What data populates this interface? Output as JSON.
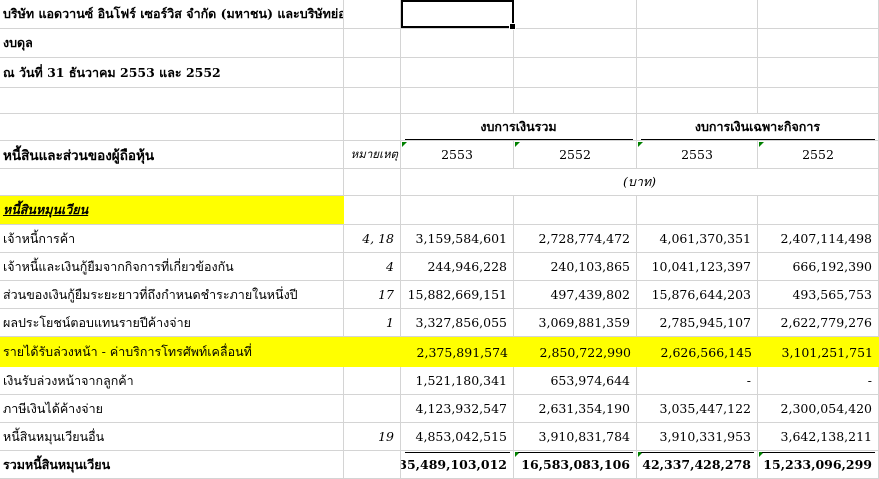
{
  "header": {
    "company": "บริษัท แอดวานซ์ อินโฟร์ เซอร์วิส จำกัด (มหาชน) และบริษัทย่อย",
    "statement": "งบดุล",
    "date_line": "ณ วันที่ 31 ธันวาคม 2553 และ 2552"
  },
  "columns": {
    "group_consolidated": "งบการเงินรวม",
    "group_separate": "งบการเงินเฉพาะกิจการ",
    "section_title": "หนี้สินและส่วนของผู้ถือหุ้น",
    "note_label": "หมายเหตุ",
    "years": [
      "2553",
      "2552",
      "2553",
      "2552"
    ],
    "unit": "(บาท)"
  },
  "section": {
    "current_liabilities": "หนี้สินหมุนเวียน"
  },
  "rows": [
    {
      "label": "เจ้าหนี้การค้า",
      "note": "4, 18",
      "values": [
        "3,159,584,601",
        "2,728,774,472",
        "4,061,370,351",
        "2,407,114,498"
      ]
    },
    {
      "label": "เจ้าหนี้และเงินกู้ยืมจากกิจการที่เกี่ยวข้องกัน",
      "note": "4",
      "values": [
        "244,946,228",
        "240,103,865",
        "10,041,123,397",
        "666,192,390"
      ]
    },
    {
      "label": "ส่วนของเงินกู้ยืมระยะยาวที่ถึงกำหนดชำระภายในหนึ่งปี",
      "note": "17",
      "values": [
        "15,882,669,151",
        "497,439,802",
        "15,876,644,203",
        "493,565,753"
      ]
    },
    {
      "label": "ผลประโยชน์ตอบแทนรายปีค้างจ่าย",
      "note": "1",
      "values": [
        "3,327,856,055",
        "3,069,881,359",
        "2,785,945,107",
        "2,622,779,276"
      ]
    },
    {
      "label": "รายได้รับล่วงหน้า - ค่าบริการโทรศัพท์เคลื่อนที่",
      "note": "",
      "values": [
        "2,375,891,574",
        "2,850,722,990",
        "2,626,566,145",
        "3,101,251,751"
      ]
    },
    {
      "label": "เงินรับล่วงหน้าจากลูกค้า",
      "note": "",
      "values": [
        "1,521,180,341",
        "653,974,644",
        "-",
        "-"
      ]
    },
    {
      "label": "ภาษีเงินได้ค้างจ่าย",
      "note": "",
      "values": [
        "4,123,932,547",
        "2,631,354,190",
        "3,035,447,122",
        "2,300,054,420"
      ]
    },
    {
      "label": "หนี้สินหมุนเวียนอื่น",
      "note": "19",
      "values": [
        "4,853,042,515",
        "3,910,831,784",
        "3,910,331,953",
        "3,642,138,211"
      ]
    }
  ],
  "total": {
    "label": "รวมหนี้สินหมุนเวียน",
    "values": [
      "35,489,103,012",
      "16,583,083,106",
      "42,337,428,278",
      "15,233,096,299"
    ]
  },
  "colors": {
    "highlight": "#ffff00",
    "gridline": "#d4d4d4",
    "comment_marker": "#008000"
  }
}
